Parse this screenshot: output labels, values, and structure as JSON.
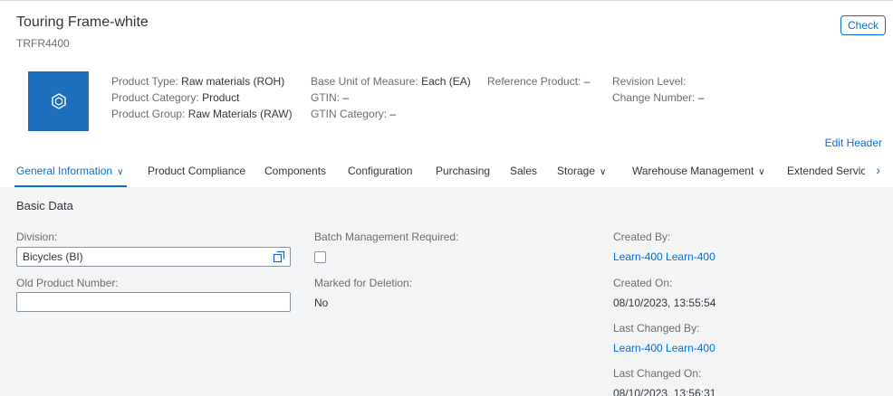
{
  "header": {
    "title": "Touring Frame-white",
    "product_id": "TRFR4400",
    "check_label": "Check",
    "edit_header_label": "Edit Header",
    "attributes": {
      "col1": [
        {
          "label": "Product Type:",
          "value": "Raw materials (ROH)"
        },
        {
          "label": "Product Category:",
          "value": "Product"
        },
        {
          "label": "Product Group:",
          "value": "Raw Materials (RAW)"
        }
      ],
      "col2": [
        {
          "label": "Base Unit of Measure:",
          "value": "Each (EA)"
        },
        {
          "label": "GTIN:",
          "value": "–"
        },
        {
          "label": "GTIN Category:",
          "value": "–"
        }
      ],
      "col3": [
        {
          "label": "Reference Product:",
          "value": "–"
        }
      ],
      "col4": [
        {
          "label": "Revision Level:",
          "value": ""
        },
        {
          "label": "Change Number:",
          "value": "–"
        }
      ]
    },
    "avatar_icon": "product-box-icon",
    "accent_color": "#0a6ed1"
  },
  "tabs": [
    {
      "label": "General Information",
      "has_dropdown": true,
      "active": true
    },
    {
      "label": "Product Compliance",
      "has_dropdown": false
    },
    {
      "label": "Components",
      "has_dropdown": false
    },
    {
      "label": "Configuration",
      "has_dropdown": false
    },
    {
      "label": "Purchasing",
      "has_dropdown": false
    },
    {
      "label": "Sales",
      "has_dropdown": false
    },
    {
      "label": "Storage",
      "has_dropdown": true
    },
    {
      "label": "Warehouse Management",
      "has_dropdown": true
    },
    {
      "label": "Extended Servic",
      "has_dropdown": false
    }
  ],
  "basic_data": {
    "section_title": "Basic Data",
    "division_label": "Division:",
    "division_value": "Bicycles (BI)",
    "old_product_number_label": "Old Product Number:",
    "old_product_number_value": "",
    "batch_management_label": "Batch Management Required:",
    "batch_management_checked": false,
    "marked_for_deletion_label": "Marked for Deletion:",
    "marked_for_deletion_value": "No",
    "created_by_label": "Created By:",
    "created_by_value": "Learn-400 Learn-400",
    "created_on_label": "Created On:",
    "created_on_value": "08/10/2023, 13:55:54",
    "last_changed_by_label": "Last Changed By:",
    "last_changed_by_value": "Learn-400 Learn-400",
    "last_changed_on_label": "Last Changed On:",
    "last_changed_on_value": "08/10/2023, 13:56:31"
  }
}
